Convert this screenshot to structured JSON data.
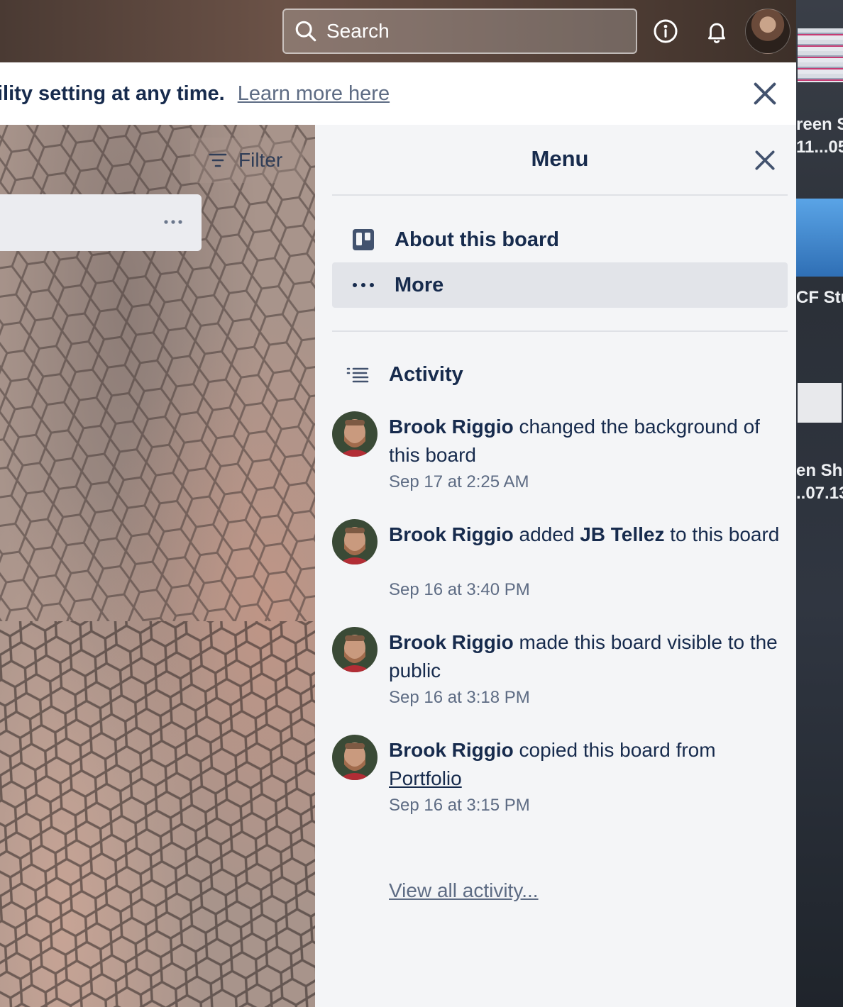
{
  "header": {
    "search_placeholder": "Search",
    "icons": [
      "search-icon",
      "info-icon",
      "bell-icon",
      "avatar"
    ]
  },
  "banner": {
    "text": "ility setting at any time.",
    "link": "Learn more here"
  },
  "board": {
    "filter_label": "Filter",
    "list_menu": "..."
  },
  "menu": {
    "title": "Menu",
    "items": [
      {
        "label": "About this board",
        "icon": "board-icon"
      },
      {
        "label": "More",
        "icon": "ellipsis-icon"
      }
    ],
    "activity_title": "Activity",
    "activities": [
      {
        "user": "Brook Riggio",
        "text": " changed the background of this board",
        "time": "Sep 17 at 2:25 AM"
      },
      {
        "user": "Brook Riggio",
        "text": " added ",
        "target": "JB Tellez",
        "text2": " to this board",
        "time": "Sep 16 at 3:40 PM"
      },
      {
        "user": "Brook Riggio",
        "text": " made this board visible to the public",
        "time": "Sep 16 at 3:18 PM"
      },
      {
        "user": "Brook Riggio",
        "text": " copied this board from ",
        "link": "Portfolio",
        "time": "Sep 16 at 3:15 PM"
      }
    ],
    "view_all": "View all activity..."
  },
  "desktop": {
    "labels": [
      "reen S",
      "11...05",
      "CF Stu",
      "en Sho",
      "..07.13"
    ]
  },
  "colors": {
    "text_primary": "#172b4d",
    "text_subtle": "#5e6c84",
    "panel_bg": "#f4f5f7",
    "active_item_bg": "#e2e4e9"
  }
}
